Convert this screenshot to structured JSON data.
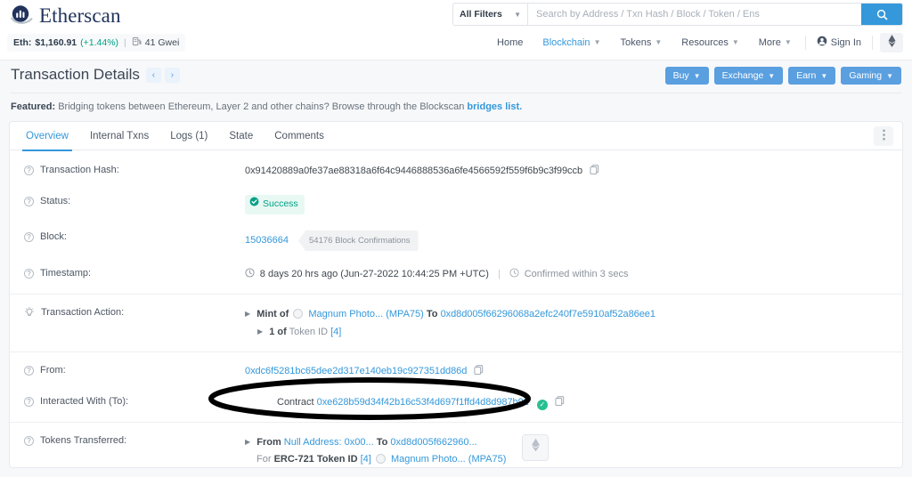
{
  "brand": {
    "name": "Etherscan"
  },
  "price_bar": {
    "label": "Eth:",
    "price": "$1,160.91",
    "change": "(+1.44%)",
    "separator": "|",
    "gas": "41 Gwei"
  },
  "search": {
    "filter_label": "All Filters",
    "placeholder": "Search by Address / Txn Hash / Block / Token / Ens",
    "value": "",
    "button_icon": "search-icon"
  },
  "nav": {
    "items": [
      {
        "label": "Home",
        "has_caret": false,
        "active": false
      },
      {
        "label": "Blockchain",
        "has_caret": true,
        "active": true
      },
      {
        "label": "Tokens",
        "has_caret": true,
        "active": false
      },
      {
        "label": "Resources",
        "has_caret": true,
        "active": false
      },
      {
        "label": "More",
        "has_caret": true,
        "active": false
      }
    ],
    "sign_in": "Sign In",
    "network_icon": "ethereum-icon"
  },
  "header": {
    "title": "Transaction Details",
    "prev_arrow": "‹",
    "next_arrow": "›"
  },
  "toolbar": {
    "buttons": [
      {
        "label": "Buy"
      },
      {
        "label": "Exchange"
      },
      {
        "label": "Earn"
      },
      {
        "label": "Gaming"
      }
    ]
  },
  "featured": {
    "prefix": "Featured:",
    "text": "Bridging tokens between Ethereum, Layer 2 and other chains? Browse through the Blockscan",
    "link": "bridges list."
  },
  "tabs": [
    {
      "label": "Overview",
      "active": true
    },
    {
      "label": "Internal Txns",
      "active": false
    },
    {
      "label": "Logs (1)",
      "active": false
    },
    {
      "label": "State",
      "active": false
    },
    {
      "label": "Comments",
      "active": false
    }
  ],
  "details": {
    "transaction_hash": {
      "label": "Transaction Hash:",
      "value": "0x91420889a0fe37ae88318a6f64c9446888536a6fe4566592f559f6b9c3f99ccb"
    },
    "status": {
      "label": "Status:",
      "value": "Success"
    },
    "block": {
      "label": "Block:",
      "number": "15036664",
      "confirmations": "54176 Block Confirmations"
    },
    "timestamp": {
      "label": "Timestamp:",
      "relative": "8 days 20 hrs ago",
      "absolute": "(Jun-27-2022 10:44:25 PM +UTC)",
      "separator": "|",
      "confirmed": "Confirmed within 3 secs"
    },
    "transaction_action": {
      "label": "Transaction Action:",
      "line1_prefix": "Mint of",
      "line1_token": "Magnum Photo...",
      "line1_symbol": "(MPA75)",
      "line1_to_label": "To",
      "line1_to_address": "0xd8d005f66296068a2efc240f7e5910af52a86ee1",
      "line2_prefix": "1 of",
      "line2_token_id_label": "Token ID",
      "line2_token_id": "[4]"
    },
    "from": {
      "label": "From:",
      "address": "0xdc6f5281bc65dee2d317e140eb19c927351dd86d"
    },
    "interacted_with": {
      "label": "Interacted With (To):",
      "prefix": "Contract",
      "address": "0xe628b59d34f42b16c53f4d697f1ffd4d8d987b91",
      "verified_icon": "verified-check-icon"
    },
    "tokens_transferred": {
      "label": "Tokens Transferred:",
      "from_label": "From",
      "from_value": "Null Address: 0x00...",
      "to_label": "To",
      "to_value": "0xd8d005f662960...",
      "for_label": "For",
      "standard": "ERC-721",
      "token_id_label": "Token ID",
      "token_id": "[4]",
      "token_name": "Magnum Photo...",
      "token_symbol": "(MPA75)"
    }
  },
  "annotation": {
    "type": "ellipse-highlight",
    "target": "interacted-with-contract-address"
  },
  "colors": {
    "accent": "#3498db",
    "brand_dark": "#21325b",
    "success": "#00a186",
    "page_bg": "#f7f8fa"
  }
}
